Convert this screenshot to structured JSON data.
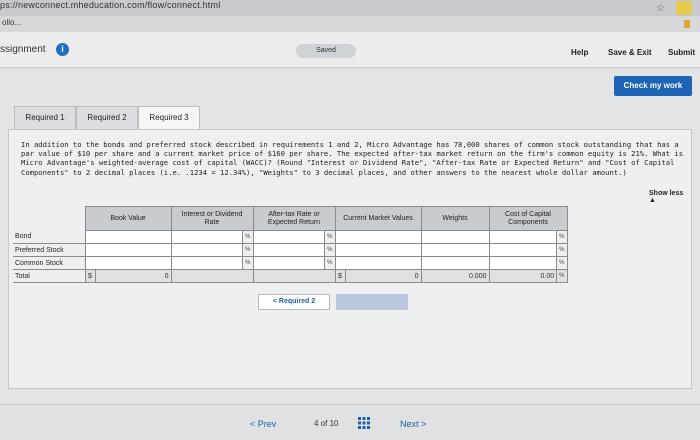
{
  "browser": {
    "url": "ps://newconnect.mheducation.com/flow/connect.html",
    "bookmark": "olio..."
  },
  "header": {
    "title": "ssignment",
    "saved": "Saved",
    "help": "Help",
    "save_exit": "Save & Exit",
    "submit": "Submit"
  },
  "check_work": "Check my work",
  "tabs": [
    "Required 1",
    "Required 2",
    "Required 3"
  ],
  "question": "In addition to the bonds and preferred stock described in requirements 1 and 2, Micro Advantage has 78,000 shares of common stock outstanding that has a par value of $10 per share and a current market price of $160 per share. The expected after-tax market return on the firm's common equity is 21%. What is Micro Advantage's weighted-average cost of capital (WACC)? (Round \"Interest or Dividend Rate\", \"After-tax Rate or Expected Return\" and \"Cost of Capital Components\" to 2 decimal places (i.e. .1234 = 12.34%), \"Weights\" to 3 decimal places, and other answers to the nearest whole dollar amount.)",
  "show_less": "Show less ▲",
  "table": {
    "headers": [
      "Book Value",
      "Interest or Dividend Rate",
      "After-tax Rate or Expected Return",
      "Current Market Values",
      "Weights",
      "Cost of Capital Components"
    ],
    "rows": [
      {
        "label": "Bond"
      },
      {
        "label": "Preferred Stock"
      },
      {
        "label": "Common Stock"
      }
    ],
    "total": {
      "label": "Total",
      "currency": "$",
      "book_value": "0",
      "market_currency": "$",
      "market_value": "0",
      "weights": "0.000",
      "cost": "0.00",
      "cost_unit": "%"
    },
    "pct": "%"
  },
  "nav": {
    "required_prev": "< Required 2"
  },
  "pager": {
    "prev": "< Prev",
    "count": "4 of 10",
    "next": "Next >"
  }
}
